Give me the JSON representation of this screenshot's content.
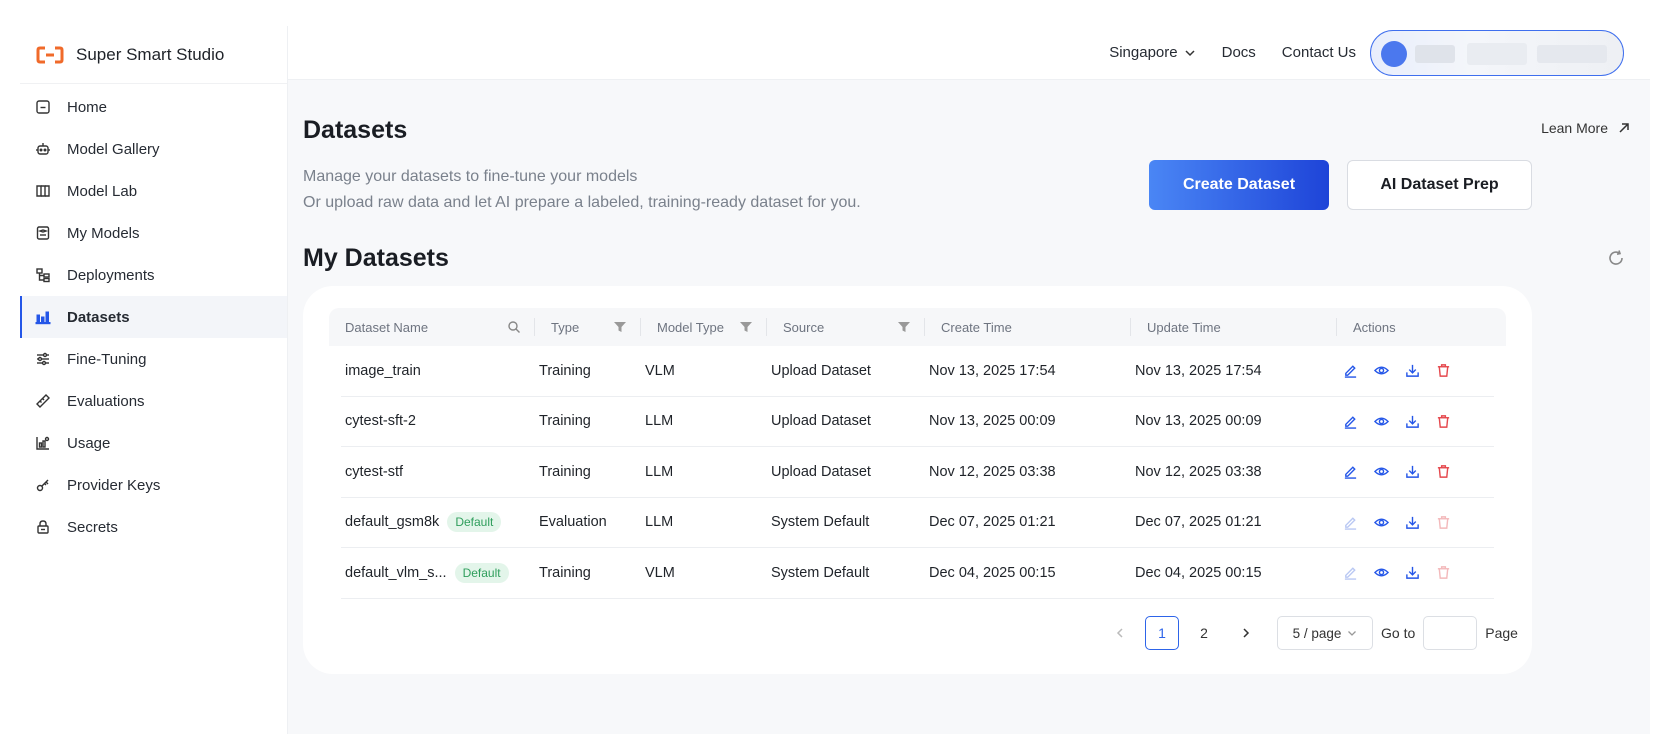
{
  "brand": {
    "name": "Super Smart Studio",
    "accent": "#f06a2a"
  },
  "sidebar": {
    "items": [
      {
        "label": "Home",
        "icon": "home-icon",
        "active": false
      },
      {
        "label": "Model Gallery",
        "icon": "robot-icon",
        "active": false
      },
      {
        "label": "Model Lab",
        "icon": "book-icon",
        "active": false
      },
      {
        "label": "My Models",
        "icon": "model-box-icon",
        "active": false
      },
      {
        "label": "Deployments",
        "icon": "deploy-tree-icon",
        "active": false
      },
      {
        "label": "Datasets",
        "icon": "bar-chart-icon",
        "active": true
      },
      {
        "label": "Fine-Tuning",
        "icon": "sliders-icon",
        "active": false
      },
      {
        "label": "Evaluations",
        "icon": "ruler-icon",
        "active": false
      },
      {
        "label": "Usage",
        "icon": "usage-chart-icon",
        "active": false
      },
      {
        "label": "Provider Keys",
        "icon": "key-icon",
        "active": false
      },
      {
        "label": "Secrets",
        "icon": "lock-icon",
        "active": false
      }
    ]
  },
  "topbar": {
    "region": "Singapore",
    "docs": "Docs",
    "contact": "Contact Us"
  },
  "page": {
    "title": "Datasets",
    "learn_more": "Lean More",
    "subtitle_line1": "Manage your datasets to fine-tune your models",
    "subtitle_line2": "Or upload raw data and let AI prepare a labeled, training-ready dataset for you.",
    "create_button": "Create Dataset",
    "prep_button": "AI Dataset Prep",
    "section_title": "My Datasets"
  },
  "table": {
    "columns": [
      {
        "label": "Dataset Name",
        "icon": "search-icon"
      },
      {
        "label": "Type",
        "icon": "filter-icon"
      },
      {
        "label": "Model Type",
        "icon": "filter-icon"
      },
      {
        "label": "Source",
        "icon": "filter-icon"
      },
      {
        "label": "Create Time",
        "icon": ""
      },
      {
        "label": "Update Time",
        "icon": ""
      },
      {
        "label": "Actions",
        "icon": ""
      }
    ],
    "rows": [
      {
        "name": "image_train",
        "badge": "",
        "type": "Training",
        "model_type": "VLM",
        "source": "Upload Dataset",
        "create_time": "Nov 13, 2025 17:54",
        "update_time": "Nov 13, 2025 17:54",
        "editable": true
      },
      {
        "name": "cytest-sft-2",
        "badge": "",
        "type": "Training",
        "model_type": "LLM",
        "source": "Upload Dataset",
        "create_time": "Nov 13, 2025 00:09",
        "update_time": "Nov 13, 2025 00:09",
        "editable": true
      },
      {
        "name": "cytest-stf",
        "badge": "",
        "type": "Training",
        "model_type": "LLM",
        "source": "Upload Dataset",
        "create_time": "Nov 12, 2025 03:38",
        "update_time": "Nov 12, 2025 03:38",
        "editable": true
      },
      {
        "name": "default_gsm8k",
        "badge": "Default",
        "type": "Evaluation",
        "model_type": "LLM",
        "source": "System Default",
        "create_time": "Dec 07, 2025 01:21",
        "update_time": "Dec 07, 2025 01:21",
        "editable": false
      },
      {
        "name": "default_vlm_s...",
        "badge": "Default",
        "type": "Training",
        "model_type": "VLM",
        "source": "System Default",
        "create_time": "Dec 04, 2025 00:15",
        "update_time": "Dec 04, 2025 00:15",
        "editable": false
      }
    ]
  },
  "pagination": {
    "pages": [
      "1",
      "2"
    ],
    "current": "1",
    "page_size": "5 / page",
    "goto_label": "Go to",
    "goto_value": "",
    "page_label": "Page"
  },
  "colors": {
    "primary": "#2456e8",
    "delete": "#e5484d",
    "badge_bg": "#e3f5ea",
    "badge_text": "#2f9e5c"
  }
}
